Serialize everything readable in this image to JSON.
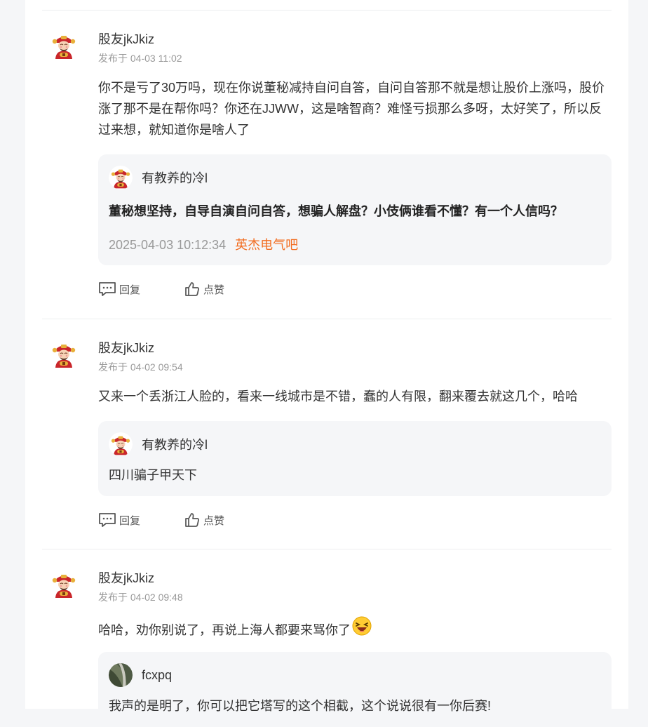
{
  "comments": [
    {
      "username": "股友jkJkiz",
      "meta": "发布于 04-03 11:02",
      "content": "你不是亏了30万吗，现在你说董秘减持自问自答，自问自答那不就是想让股价上涨吗，股价涨了那不是在帮你吗？你还在JJWW，这是啥智商？难怪亏损那么多呀，太好笑了，所以反过来想，就知道你是啥人了",
      "quote": {
        "name": "有教养的冷l",
        "text": "董秘想坚持，自导自演自问自答，想骗人解盘？小伎俩谁看不懂？有一个人信吗？",
        "time": "2025-04-03 10:12:34",
        "bar": "英杰电气吧"
      },
      "reply_label": "回复",
      "like_label": "点赞"
    },
    {
      "username": "股友jkJkiz",
      "meta": "发布于 04-02 09:54",
      "content": "又来一个丢浙江人脸的，看来一线城市是不错，蠢的人有限，翻来覆去就这几个，哈哈",
      "quote": {
        "name": "有教养的冷l",
        "text": "四川骗子甲天下"
      },
      "reply_label": "回复",
      "like_label": "点赞"
    },
    {
      "username": "股友jkJkiz",
      "meta": "发布于 04-02 09:48",
      "content": "哈哈，劝你别说了，再说上海人都要来骂你了",
      "quote": {
        "name": "fcxpq",
        "text": "我声的是明了，你可以把它塔写的这个相截，这个说说很有一你后赛!"
      },
      "reply_label": "回复",
      "like_label": "点赞"
    }
  ],
  "colors": {
    "accent": "#f26d21",
    "meta": "#999999",
    "quote_bg": "#f5f6f8"
  },
  "icons": {
    "reply": "comment-icon",
    "like": "thumbs-up-icon",
    "emoji": "laughing-emoji-icon"
  }
}
